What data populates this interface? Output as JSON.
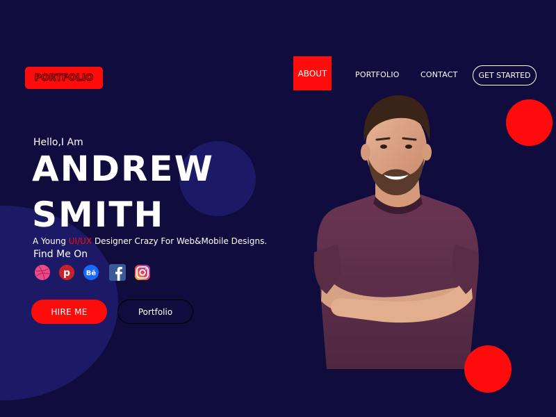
{
  "logo": {
    "text": "PORTFOLIO"
  },
  "nav": {
    "about": "ABOUT",
    "portfolio": "PORTFOLIO",
    "contact": "CONTACT",
    "get_started": "GET STARTED"
  },
  "hero": {
    "greeting": "Hello,I Am",
    "first_name": "ANDREW",
    "last_name": "SMITH",
    "tagline_pre": "A Young ",
    "tagline_accent": "UI/UX",
    "tagline_post": " Designer Crazy For Web&Mobile Designs.",
    "find_me": "Find Me On"
  },
  "social": [
    {
      "icon": "dribbble-icon",
      "color": "#ea4c89"
    },
    {
      "icon": "pinterest-icon",
      "color": "#cb2027"
    },
    {
      "icon": "behance-icon",
      "color": "#1769ff"
    },
    {
      "icon": "facebook-icon",
      "color": "#3b5998"
    },
    {
      "icon": "instagram-icon",
      "color": "#e4405f"
    }
  ],
  "buttons": {
    "hire": "HIRE ME",
    "portfolio": "Portfolio"
  },
  "colors": {
    "background": "#110c3e",
    "accent": "#fe0b0b",
    "blob": "#1c1a66"
  }
}
